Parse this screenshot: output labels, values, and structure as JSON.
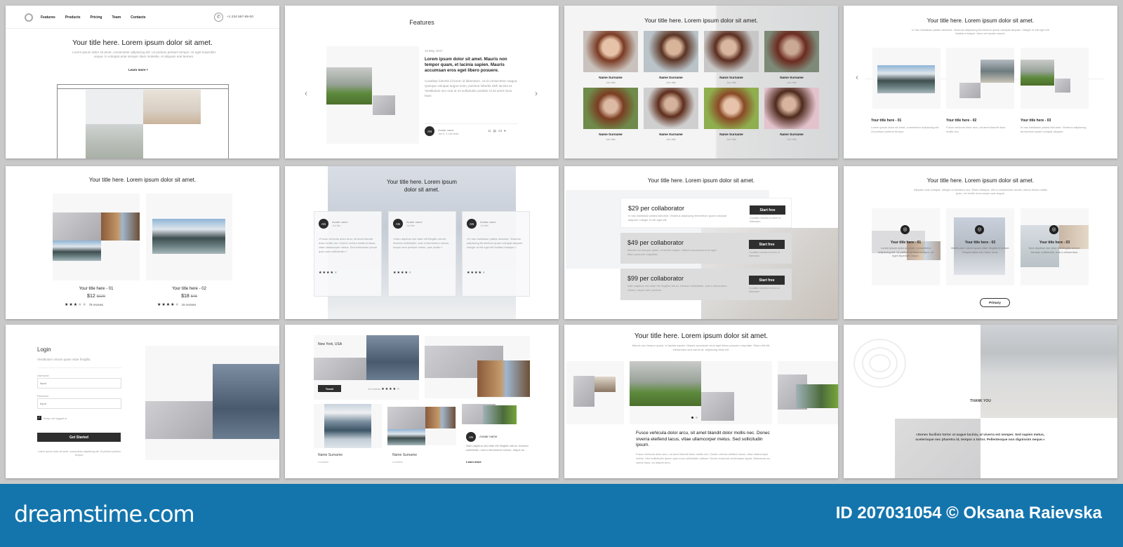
{
  "slide1": {
    "nav": [
      "Features",
      "Products",
      "Pricing",
      "Team",
      "Contacts"
    ],
    "phone": "+1 234 567-89-00",
    "title": "Your title here. Lorem ipsum dolor sit amet.",
    "text": "Lorem ipsum dolor sit amet, consectetur adipiscing elit. Ut pretium pretium tempor. Ut eget imperdiet neque. In volutpat ante semper diam molestie, et aliquam erat laoreet.",
    "link": "Learn more"
  },
  "slide2": {
    "title": "Features",
    "date": "13 May, 2017",
    "heading": "Lorem ipsum dolor sit amet. Mauris non tempor quam, et lacinia sapien. Mauris accumsan eros eget libero posuere.",
    "text": "Curabitur lobortis id lorem id bibendum. Ut id consectetur magna. Quisque volutpat augue enim, pulvinar lobortis nibh lacinia at. Vestibulum nec erat ut mi sollicitudin porttitor id sit amet risus. Nam",
    "avatar_initials": "AN",
    "avatar_name": "Avatar name",
    "avatar_meta": "Jun 9, 4 min read",
    "comments": "11",
    "likes": "23"
  },
  "slide3": {
    "title": "Your title here. Lorem ipsum dolor sit amet.",
    "members": [
      {
        "name": "Name Surname",
        "job": "Job title"
      },
      {
        "name": "Name Surname",
        "job": "Job title"
      },
      {
        "name": "Name Surname",
        "job": "Job title"
      },
      {
        "name": "Name Surname",
        "job": "Job title"
      },
      {
        "name": "Name Surname",
        "job": "Job title"
      },
      {
        "name": "Name Surname",
        "job": "Job title"
      },
      {
        "name": "Name Surname",
        "job": "Job title"
      },
      {
        "name": "Name Surname",
        "job": "Job title"
      }
    ]
  },
  "slide4": {
    "title": "Your title here. Lorem ipsum dolor sit amet.",
    "text": "In hac habitasse platea dictumst. Vivamus adipiscing fermentum quam volutpat aliquam. Integer et elit eget elit facilisis tristique. Nam vel iaculis mauris.",
    "cards": [
      {
        "title": "Your title here - 01",
        "text": "Lorem ipsum dolor sit amet, consectetur adipiscing elit. Ut pretium pretium tempor."
      },
      {
        "title": "Your title here - 02",
        "text": "Fusce vehicula dolor arcu, sit amet blandit dolor mollis nec."
      },
      {
        "title": "Your title here - 03",
        "text": "In hac habitasse platea dictumst. Vivamus adipiscing fermentum quam volutpat aliquam."
      }
    ]
  },
  "slide5": {
    "title": "Your title here. Lorem ipsum dolor sit amet.",
    "products": [
      {
        "title": "Your title here - 01",
        "price": "$12",
        "old_price": "$120",
        "rating": 3,
        "reviews": "78 reviews"
      },
      {
        "title": "Your title here - 02",
        "price": "$18",
        "old_price": "$48",
        "rating": 4,
        "reviews": "16 reviews"
      }
    ]
  },
  "slide6": {
    "title_line1": "Your title here. Lorem ipsum",
    "title_line2": "dolor sit amet.",
    "testimonials": [
      {
        "initials": "AN",
        "name": "Avatar name",
        "job": "Job title",
        "quote": "«Fusce vehicula dolor arcu, sit amet blandit dolor mollis nec. Donec viverra eleifend lacus, vitae ullamcorper metus. Sed sollicitudin ipsum quis nunc sollicitudin.»",
        "rating": 4
      },
      {
        "initials": "AN",
        "name": "Avatar name",
        "job": "Job title",
        "quote": "«Nam dapibus nisl vitae elit fringilla rutrum. Aenean sollicitudin, erat a elementum rutrum, neque sem pretium metus, quis mollis.»",
        "rating": 4
      },
      {
        "initials": "AN",
        "name": "Avatar name",
        "job": "Job title",
        "quote": "«In hac habitasse platea dictumst. Vivamus adipiscing fermentum quam volutpat aliquam. Integer et elit eget elit facilisis tristique.»",
        "rating": 4
      }
    ]
  },
  "slide7": {
    "title": "Your title here. Lorem ipsum dolor sit amet.",
    "plans": [
      {
        "price": "$29 per collaborator",
        "text": "In hac habitasse platea dictumst. Vivamus adipiscing fermentum quam volutpat aliquam. Integer et elit eget elit.",
        "button": "Start free",
        "note": "Curabitur lobortis id lorem id bibendum"
      },
      {
        "price": "$49 per collaborator",
        "text": "Mauris non tempor quam, et lacinia sapien. Mauris accumsan eros eget libero posuere vulputate.",
        "button": "Start free",
        "note": "Curabitur lobortis id lorem id bibendum"
      },
      {
        "price": "$99 per collaborator",
        "text": "Nam dapibus nisl vitae elit fringilla rutrum. Aenean sollicitudin, erat a elementum rutrum, neque sem pretium.",
        "button": "Start free",
        "note": "Curabitur lobortis id lorem id bibendum"
      }
    ]
  },
  "slide8": {
    "title": "Your title here. Lorem ipsum dolor sit amet.",
    "text": "Aliquam erat volutpat. Integer ut tincidunt orci. Etiam tristique, elit ut consectetur iaculis, metus lectus mattis justo, vel mollis eros neque quis augue.",
    "cards": [
      {
        "title": "Your title here - 01",
        "text": "Lorem ipsum dolor sit amet, consectetur adipiscing elit. Ut pretium pretium tempor. Ut eget imperdiet neque."
      },
      {
        "title": "Your title here - 02",
        "text": "Vestibulum rutrum quam vitae fringilla tincidunt. Suspendisse nec tortor urna."
      },
      {
        "title": "Your title here - 03",
        "text": "Nam dapibus nisl vitae elit fringilla rutrum. Aenean sollicitudin, erat a elementum."
      }
    ],
    "button": "Primary"
  },
  "slide9": {
    "title": "Login",
    "subtitle": "Vestibulum rutrum quam vitae fringilla.",
    "username_label": "Username",
    "username_placeholder": "Input",
    "password_label": "Password",
    "password_placeholder": "Input",
    "remember": "Keep me logged in",
    "remember_checked": true,
    "button": "Get Started",
    "footnote": "Lorem ipsum dolor sit amet, consectetur adipiscing elit. Ut pretium pretium tempor."
  },
  "slide10": {
    "location": "New York, USA",
    "tag": "Travel",
    "reviews": "13 reviews",
    "rating": 4,
    "people": [
      {
        "name": "Name Surname",
        "location": "Location"
      },
      {
        "name": "Name Surname",
        "location": "Location"
      }
    ],
    "avatar_initials": "AN",
    "avatar_name": "Avatar name",
    "text": "Nam dapibus nisl vitae elit fringilla rutrum. Aenean sollicitudin, erat a elementum rutrum, neque se",
    "link": "Learn more"
  },
  "slide11": {
    "title": "Your title here. Lorem ipsum dolor sit amet.",
    "text": "Mauris non tempor quam, et lacinia sapien. Mauris accumsan eros eget libero posuere vulputate. Etiam elit elit, elementum sed varius at, adipiscing vitae est.",
    "heading": "Fusce vehicula dolor arcu, sit amet blandit dolor mollis nec. Donec viverra eleifend lacus, vitae ullamcorper metus. Sed sollicitudin ipsum.",
    "body": "Fusce vehicula dolor arcu, sit amet blandit dolor mollis nec. Donec viverra eleifend lacus, vitae ullamcorper metus. Sed sollicitudin ipsum quis nunc sollicitudin ultrices. Donec euismod scelerisque ligula. Maecenas eu varius risus, eu aliquet arcu."
  },
  "slide12": {
    "title": "THANK YOU",
    "quote": "«Donec facilisis tortor ut augue lacinia, at viverra est semper. Sed sapien metus, scelerisque nec pharetra id, tempor a tortor. Pellentesque non dignissim neque.»"
  },
  "footer": {
    "brand": "dreamstime.com",
    "credit": "ID 207031054 © Oksana Raievska",
    "color": "#1475ad"
  }
}
